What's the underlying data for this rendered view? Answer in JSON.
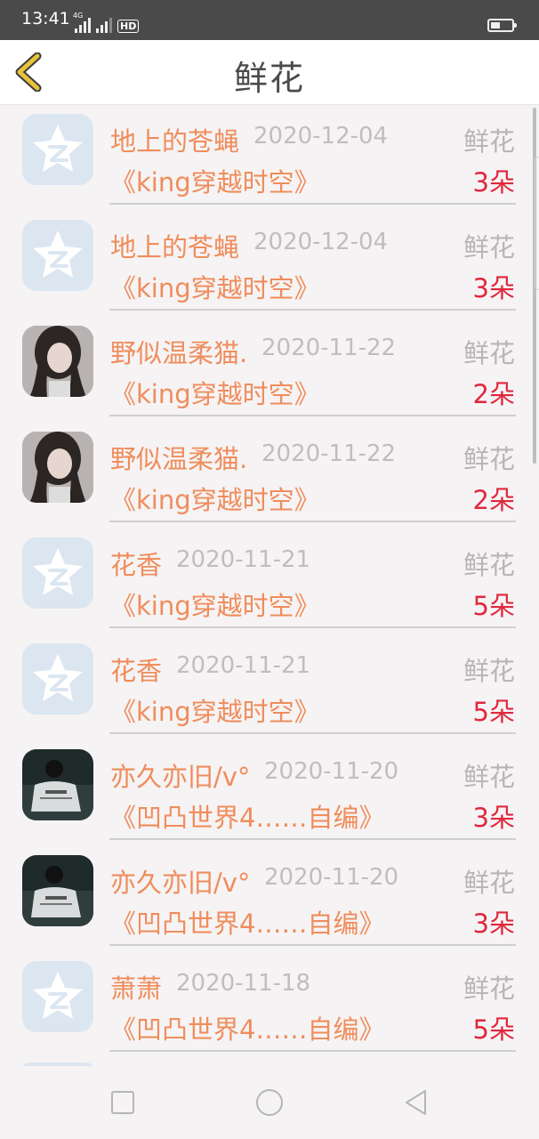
{
  "status_bar": {
    "time": "13:41",
    "network": "4G",
    "hd": "HD"
  },
  "header": {
    "title": "鲜花"
  },
  "rows": [
    {
      "avatar": "qq-logo",
      "nickname": "地上的苍蝇",
      "date": "2020-12-04",
      "gift": "鲜花",
      "work": "《king穿越时空》",
      "count": "3朵"
    },
    {
      "avatar": "qq-logo",
      "nickname": "地上的苍蝇",
      "date": "2020-12-04",
      "gift": "鲜花",
      "work": "《king穿越时空》",
      "count": "3朵"
    },
    {
      "avatar": "photo-girl",
      "nickname": "野似温柔猫.",
      "date": "2020-11-22",
      "gift": "鲜花",
      "work": "《king穿越时空》",
      "count": "2朵"
    },
    {
      "avatar": "photo-girl",
      "nickname": "野似温柔猫.",
      "date": "2020-11-22",
      "gift": "鲜花",
      "work": "《king穿越时空》",
      "count": "2朵"
    },
    {
      "avatar": "qq-logo",
      "nickname": "花香",
      "date": "2020-11-21",
      "gift": "鲜花",
      "work": "《king穿越时空》",
      "count": "5朵"
    },
    {
      "avatar": "qq-logo",
      "nickname": "花香",
      "date": "2020-11-21",
      "gift": "鲜花",
      "work": "《king穿越时空》",
      "count": "5朵"
    },
    {
      "avatar": "photo-dark",
      "nickname": "亦久亦旧/v°",
      "date": "2020-11-20",
      "gift": "鲜花",
      "work": "《凹凸世界4……自编》",
      "count": "3朵"
    },
    {
      "avatar": "photo-dark",
      "nickname": "亦久亦旧/v°",
      "date": "2020-11-20",
      "gift": "鲜花",
      "work": "《凹凸世界4……自编》",
      "count": "3朵"
    },
    {
      "avatar": "qq-logo",
      "nickname": "萧萧",
      "date": "2020-11-18",
      "gift": "鲜花",
      "work": "《凹凸世界4……自编》",
      "count": "5朵"
    }
  ],
  "colors": {
    "nickname": "#ef8d5c",
    "count": "#e0283d",
    "gift": "#b9b4b6",
    "date": "#c2bcbe",
    "back_arrow": "#e7c23a"
  }
}
